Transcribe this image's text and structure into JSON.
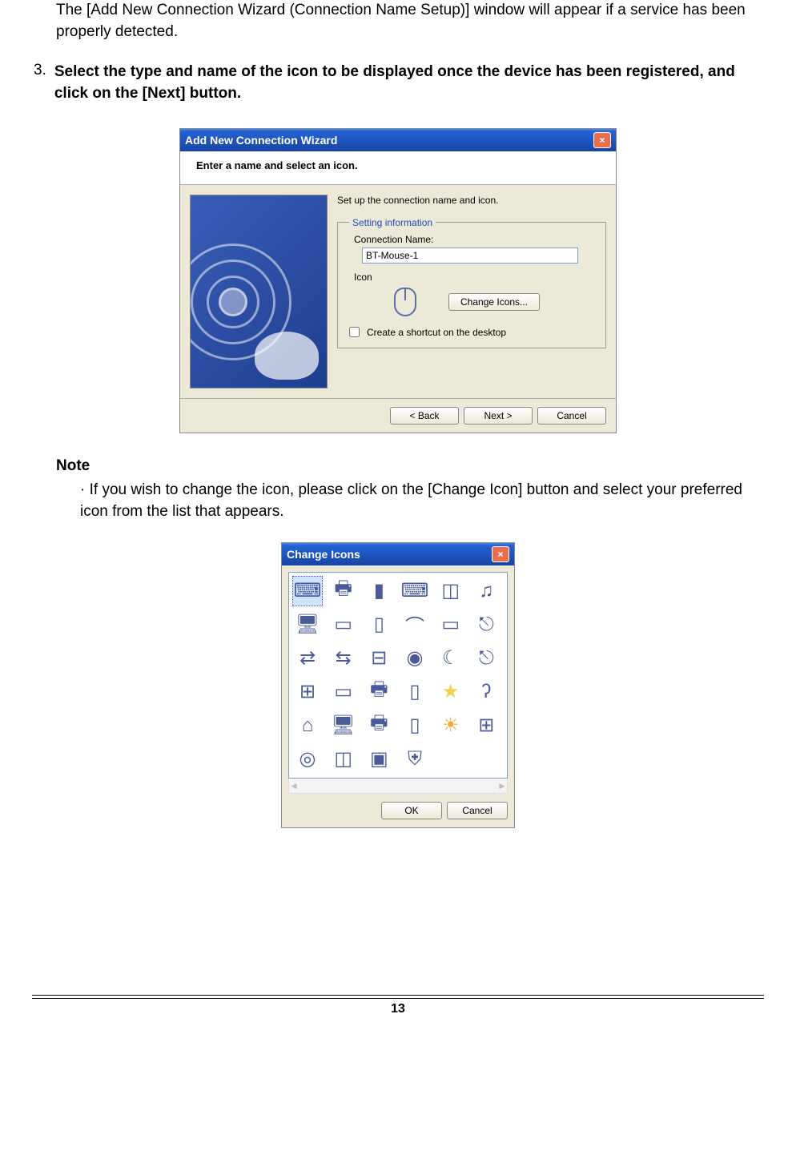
{
  "intro": "The [Add New Connection Wizard (Connection Name Setup)] window will appear if a service has been properly detected.",
  "step": {
    "number": "3.",
    "text": "Select the type and name of the icon to be displayed once the device has been registered, and click on the [Next] button."
  },
  "wizard": {
    "title": "Add New Connection Wizard",
    "subtitle": "Enter a name and select an icon.",
    "instruction": "Set up the connection name and icon.",
    "legend": "Setting information",
    "conn_label": "Connection Name:",
    "conn_value": "BT-Mouse-1",
    "icon_label": "Icon",
    "change_btn": "Change Icons...",
    "shortcut_label": "Create a shortcut on the desktop",
    "back": "< Back",
    "next": "Next >",
    "cancel": "Cancel"
  },
  "note": {
    "heading": "Note",
    "body": "· If you wish to change the icon, please click on the [Change Icon] button and select your preferred icon from the list that appears."
  },
  "icons_dialog": {
    "title": "Change Icons",
    "ok": "OK",
    "cancel": "Cancel"
  },
  "page_number": "13"
}
